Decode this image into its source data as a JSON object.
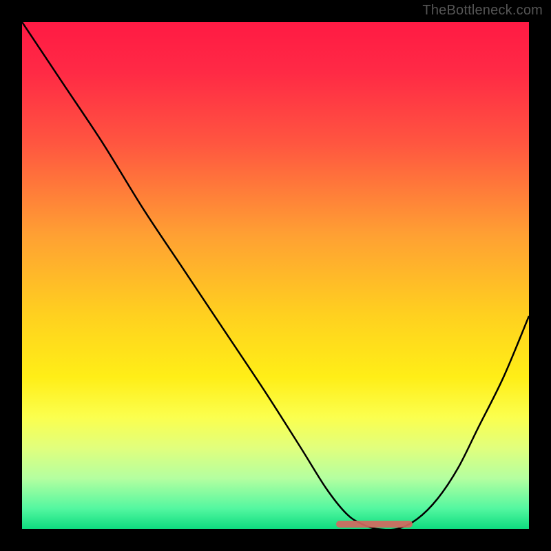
{
  "watermark": "TheBottleneck.com",
  "colors": {
    "frame": "#000000",
    "gradient_top": "#ff1a44",
    "gradient_bottom": "#0edc7f",
    "curve": "#000000",
    "bump": "#d4685f"
  },
  "chart_data": {
    "type": "line",
    "title": "",
    "xlabel": "",
    "ylabel": "",
    "xlim": [
      0,
      100
    ],
    "ylim": [
      0,
      100
    ],
    "grid": false,
    "legend": false,
    "series": [
      {
        "name": "bottleneck-curve",
        "x": [
          0,
          8,
          16,
          24,
          32,
          40,
          48,
          55,
          60,
          64,
          67,
          70,
          74,
          78,
          82,
          86,
          90,
          95,
          100
        ],
        "y": [
          100,
          88,
          76,
          63,
          51,
          39,
          27,
          16,
          8,
          3,
          1,
          0,
          0,
          2,
          6,
          12,
          20,
          30,
          42
        ]
      }
    ],
    "markers": [
      {
        "name": "optimal-range",
        "x_start": 62,
        "x_end": 77,
        "y": 0
      }
    ]
  }
}
